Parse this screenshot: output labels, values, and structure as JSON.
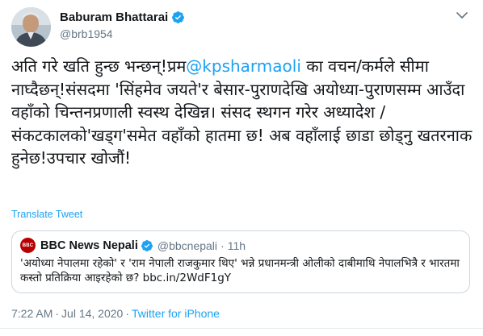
{
  "author": {
    "display_name": "Baburam Bhattarai",
    "handle": "@brb1954",
    "verified_icon": "verified-badge-icon",
    "caret_icon": "chevron-down-icon"
  },
  "tweet": {
    "text_before": "अति गरे खति हुन्छ भन्छन्!प्रम",
    "mention": "@kpsharmaoli",
    "text_after": " का वचन/कर्मले सीमा नाघ्दैछन्!संसदमा 'सिंहमेव जयते'र बेसार-पुराणदेखि अयोध्या-पुराणसम्म आउँदा वहाँको चिन्तनप्रणाली स्वस्थ देखिन्न। संसद स्थगन गरेर अध्यादेश /संकटकालको'खड्ग'समेत वहाँको हातमा छ! अब वहाँलाई छाडा छोड्नु खतरनाक हुनेछ!उपचार खोजौं!",
    "translate_label": "Translate Tweet"
  },
  "quoted": {
    "logo_text": "BBC",
    "display_name": "BBC News Nepali",
    "handle": "@bbcnepali",
    "dot": "·",
    "time": "11h",
    "text": "'अयोध्या नेपालमा रहेको' र 'राम नेपाली राजकुमार थिए' भन्ने प्रधानमन्त्री ओलीको दाबीमाथि नेपालभित्रै र भारतमा कस्तो प्रतिक्रिया आइरहेको छ? bbc.in/2WdF1gY"
  },
  "meta": {
    "time": "7:22 AM",
    "sep": "·",
    "date": "Jul 14, 2020",
    "source": "Twitter for iPhone"
  },
  "colors": {
    "accent": "#1da1f2",
    "text": "#14171a",
    "muted": "#657786",
    "border": "#ccd6dd",
    "bbc_red": "#b80000"
  }
}
